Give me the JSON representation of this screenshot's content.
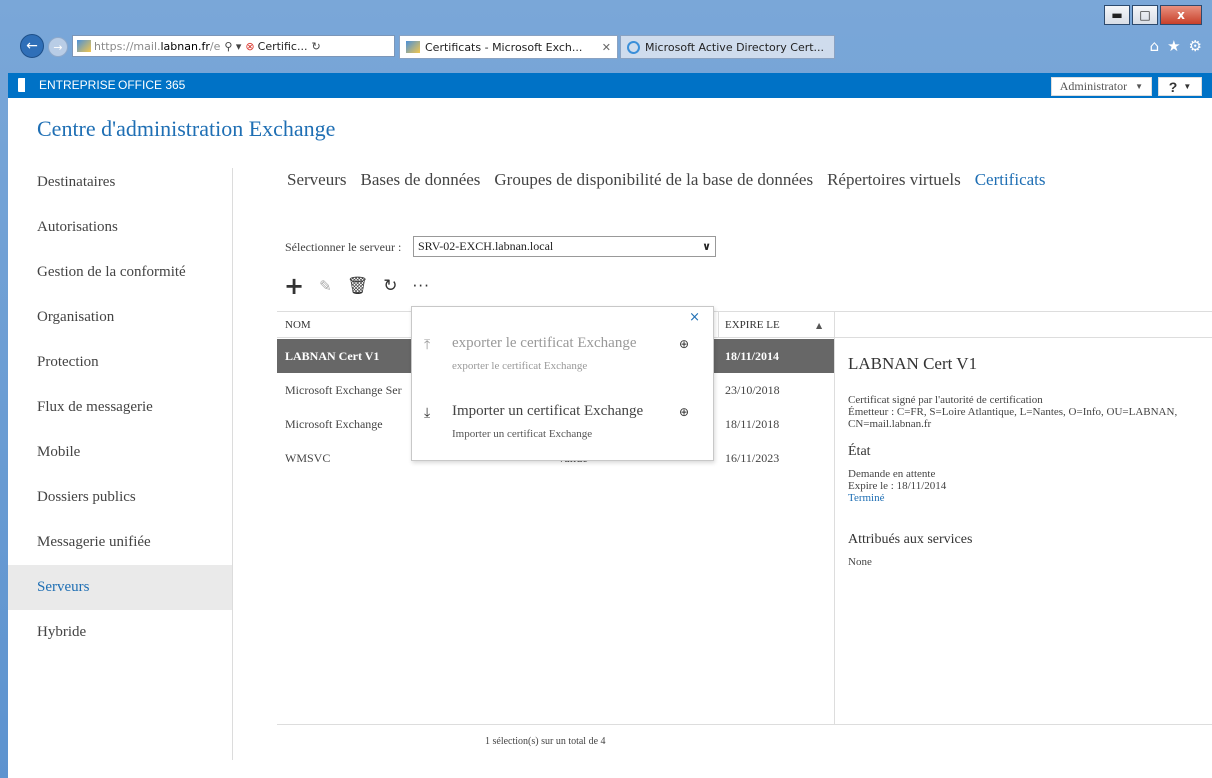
{
  "browser": {
    "address": {
      "host_prefix": "https://mail.",
      "host": "labnan.fr",
      "path_dim": "/e"
    },
    "tabs": [
      {
        "label": "Certific...",
        "active": false
      },
      {
        "label": "Certificats - Microsoft Exch...",
        "active": true
      },
      {
        "label": "Microsoft Active Directory Cert...",
        "active": false
      }
    ],
    "window_controls": {
      "minimize": "▬",
      "maximize": "□",
      "close": "x"
    }
  },
  "o365bar": {
    "entreprise": "ENTREPRISE",
    "office365": "OFFICE 365",
    "user": "Administrator",
    "help": "?"
  },
  "page": {
    "title": "Centre d'administration Exchange"
  },
  "sidebar": {
    "items": [
      {
        "label": "Destinataires"
      },
      {
        "label": "Autorisations"
      },
      {
        "label": "Gestion de la conformité"
      },
      {
        "label": "Organisation"
      },
      {
        "label": "Protection"
      },
      {
        "label": "Flux de messagerie"
      },
      {
        "label": "Mobile"
      },
      {
        "label": "Dossiers publics"
      },
      {
        "label": "Messagerie unifiée"
      },
      {
        "label": "Serveurs",
        "active": true
      },
      {
        "label": "Hybride"
      }
    ]
  },
  "subnav": {
    "tabs": [
      {
        "label": "Serveurs"
      },
      {
        "label": "Bases de données"
      },
      {
        "label": "Groupes de disponibilité de la base de données"
      },
      {
        "label": "Répertoires virtuels"
      },
      {
        "label": "Certificats",
        "active": true
      }
    ]
  },
  "server_picker": {
    "label": "Sélectionner le serveur :",
    "value": "SRV-02-EXCH.labnan.local"
  },
  "toolbar": {
    "add": "+",
    "edit": "✎",
    "delete": "🗑",
    "refresh": "↻",
    "more": "···"
  },
  "table": {
    "headers": {
      "name": "NOM",
      "expires": "EXPIRE LE"
    },
    "rows": [
      {
        "name": "LABNAN Cert V1",
        "status": "",
        "expires": "18/11/2014",
        "selected": true
      },
      {
        "name": "Microsoft Exchange Ser",
        "status": "",
        "expires": "23/10/2018"
      },
      {
        "name": "Microsoft Exchange",
        "status": "",
        "expires": "18/11/2018"
      },
      {
        "name": "WMSVC",
        "status": "Valide",
        "expires": "16/11/2023"
      }
    ],
    "status_text": "1 sélection(s) sur un total de 4"
  },
  "popup": {
    "close": "×",
    "items": [
      {
        "label": "exporter le certificat Exchange",
        "description": "exporter le certificat Exchange",
        "icon": "upload-icon",
        "enabled": false
      },
      {
        "label": "Importer un certificat Exchange",
        "description": "Importer un certificat Exchange",
        "icon": "download-icon",
        "enabled": true
      }
    ]
  },
  "details": {
    "title": "LABNAN Cert V1",
    "desc1": "Certificat signé par l'autorité de certification",
    "desc2": "Émetteur : C=FR, S=Loire Atlantique, L=Nantes, O=Info, OU=LABNAN, CN=mail.labnan.fr",
    "state_heading": "État",
    "state_value": "Demande en attente",
    "expires": "Expire le : 18/11/2014",
    "complete_link": "Terminé",
    "services_heading": "Attribués aux services",
    "services_value": "None"
  },
  "colors": {
    "accent": "#1f6fb4",
    "o365_bar": "#0072c6",
    "selected_row": "#676767"
  }
}
